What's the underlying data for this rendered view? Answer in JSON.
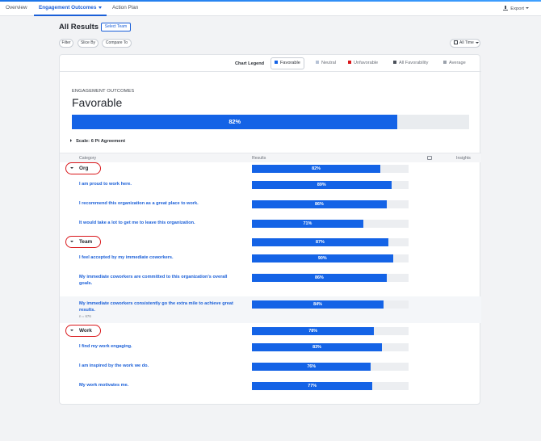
{
  "nav": {
    "tabs": [
      {
        "label": "Overview"
      },
      {
        "label": "Engagement Outcomes"
      },
      {
        "label": "Action Plan"
      }
    ],
    "export_label": "Export"
  },
  "header": {
    "title": "All Results",
    "select_team": "Select Team",
    "filters": [
      "Filter",
      "Slice By",
      "Compare To"
    ],
    "time_range": "All Time"
  },
  "legend": {
    "label": "Chart Legend",
    "items": [
      {
        "label": "Favorable",
        "color": "#1463e6"
      },
      {
        "label": "Neutral",
        "color": "#b7c3d6"
      },
      {
        "label": "Unfavorable",
        "color": "#d9161a"
      },
      {
        "label": "All Favorability",
        "color": "#4a5059"
      },
      {
        "label": "Average",
        "color": "#9aa1ab"
      }
    ]
  },
  "summary": {
    "section": "ENGAGEMENT OUTCOMES",
    "title": "Favorable",
    "overall": 82,
    "overall_label": "82%",
    "scale": "Scale: 6 Pt Agreement"
  },
  "table": {
    "col_category": "Category",
    "col_results": "Results",
    "col_insights": "Insights"
  },
  "groups": [
    {
      "name": "Org",
      "value": 82,
      "value_label": "82%",
      "questions": [
        {
          "text": "I am proud to work here.",
          "value": 89,
          "value_label": "89%"
        },
        {
          "text": "I recommend this organization as a great place to work.",
          "value": 86,
          "value_label": "86%"
        },
        {
          "text": "It would take a lot to get me to leave this organization.",
          "value": 71,
          "value_label": "71%"
        }
      ]
    },
    {
      "name": "Team",
      "value": 87,
      "value_label": "87%",
      "questions": [
        {
          "text": "I feel accepted by my immediate coworkers.",
          "value": 90,
          "value_label": "90%"
        },
        {
          "text": "My immediate coworkers are committed to this organization's overall goals.",
          "value": 86,
          "value_label": "86%"
        },
        {
          "text": "My immediate coworkers consistently go the extra mile to achieve great results.",
          "value": 84,
          "value_label": "84%",
          "n": "n = 676"
        }
      ]
    },
    {
      "name": "Work",
      "value": 78,
      "value_label": "78%",
      "questions": [
        {
          "text": "I find my work engaging.",
          "value": 83,
          "value_label": "83%"
        },
        {
          "text": "I am inspired by the work we do.",
          "value": 76,
          "value_label": "76%"
        },
        {
          "text": "My work motivates me.",
          "value": 77,
          "value_label": "77%"
        }
      ]
    }
  ]
}
